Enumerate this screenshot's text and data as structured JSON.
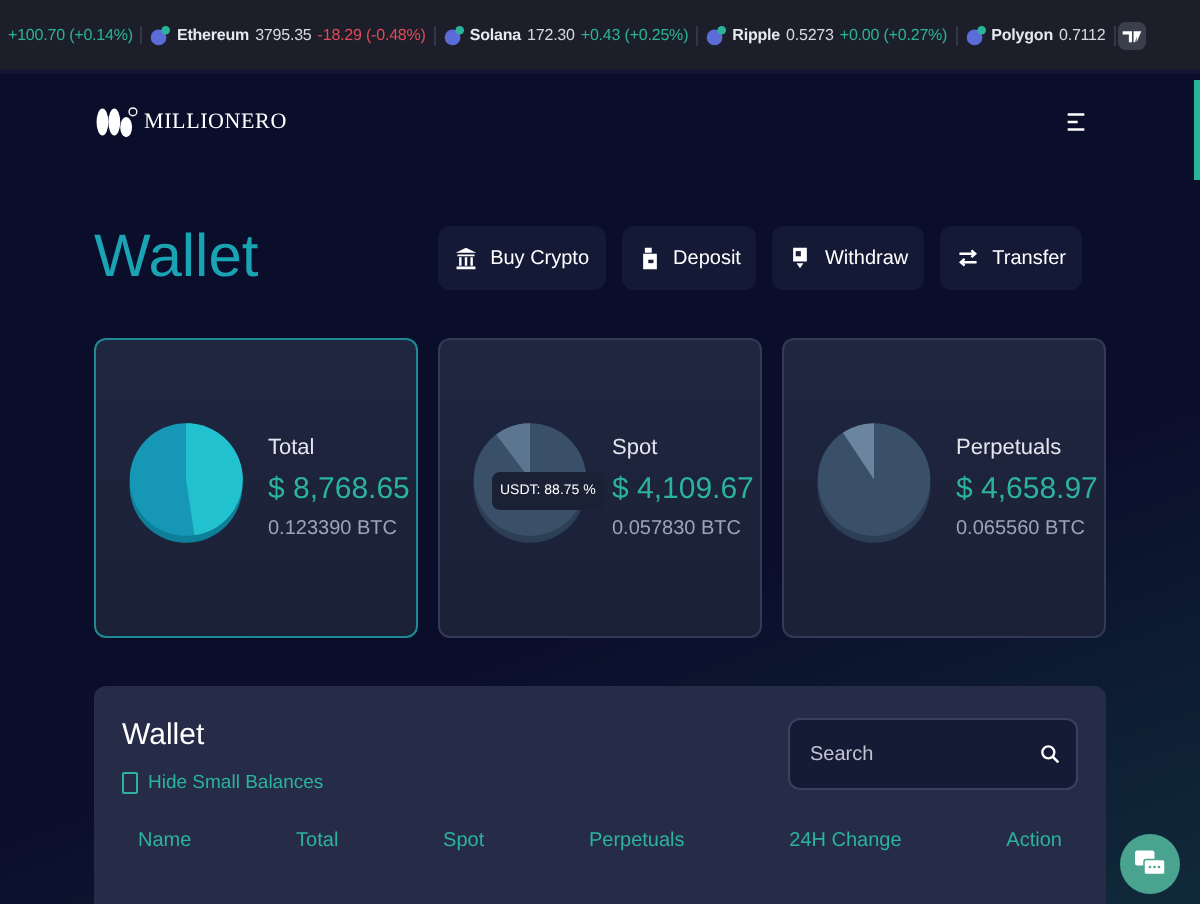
{
  "ticker": [
    {
      "change": "+100.70 (+0.14%)",
      "color": "#2bb39a"
    },
    {
      "name": "Ethereum",
      "price": "3795.35",
      "change": "-18.29 (-0.48%)",
      "color": "#e04a5a"
    },
    {
      "name": "Solana",
      "price": "172.30",
      "change": "+0.43 (+0.25%)",
      "color": "#2bb39a"
    },
    {
      "name": "Ripple",
      "price": "0.5273",
      "change": "+0.00 (+0.27%)",
      "color": "#2bb39a"
    },
    {
      "name": "Polygon",
      "price": "0.7112"
    }
  ],
  "header": {
    "logo": "MILLIONERO"
  },
  "page": {
    "title": "Wallet",
    "actions": [
      "Buy Crypto",
      "Deposit",
      "Withdraw",
      "Transfer"
    ]
  },
  "cards": [
    {
      "label": "Total",
      "amount": "$ 8,768.65",
      "btc": "0.123390 BTC",
      "selected": true
    },
    {
      "label": "Spot",
      "amount": "$ 4,109.67",
      "btc": "0.057830 BTC",
      "selected": false,
      "tooltip": "USDT: 88.75 %"
    },
    {
      "label": "Perpetuals",
      "amount": "$ 4,658.97",
      "btc": "0.065560 BTC",
      "selected": false
    }
  ],
  "wallet_table": {
    "title": "Wallet",
    "hide_small_balances": {
      "label": "Hide Small Balances",
      "checked": false
    },
    "search": {
      "placeholder": "Search"
    },
    "columns": [
      "Name",
      "Total",
      "Spot",
      "Perpetuals",
      "24H Change",
      "Action"
    ]
  }
}
